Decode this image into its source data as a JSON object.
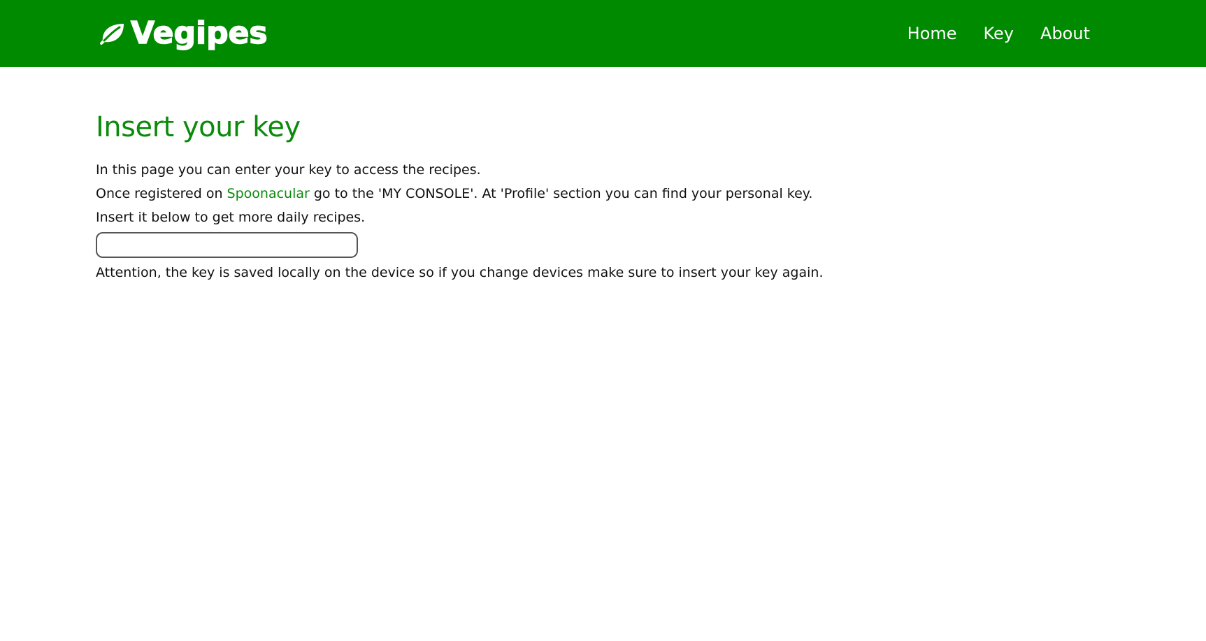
{
  "header": {
    "brand": "Vegipes",
    "brand_icon": "leaf-icon",
    "nav": {
      "home": "Home",
      "key": "Key",
      "about": "About"
    }
  },
  "main": {
    "title": "Insert your key",
    "line1": "In this page you can enter your key to access the recipes.",
    "line2_before": "Once registered on ",
    "line2_link": "Spoonacular",
    "line2_after": " go to the 'MY CONSOLE'. At 'Profile' section you can find your personal key.",
    "line3": "Insert it below to get more daily recipes.",
    "key_input": {
      "value": "",
      "placeholder": ""
    },
    "attention": "Attention, the key is saved locally on the device so if you change devices make sure to insert your key again."
  },
  "colors": {
    "header_bg": "#008a00",
    "accent": "#0c8a0c",
    "text": "#111111"
  }
}
